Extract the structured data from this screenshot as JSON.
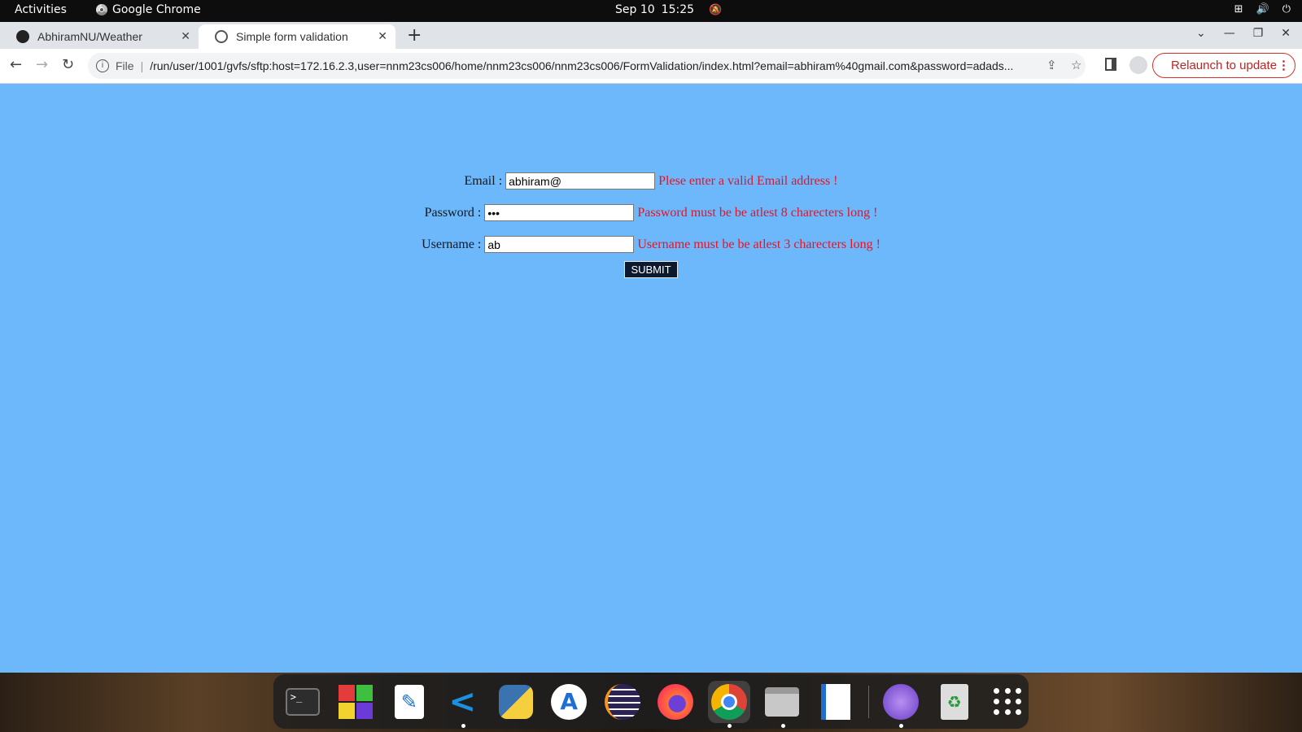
{
  "topbar": {
    "activities": "Activities",
    "app_name": "Google Chrome",
    "date": "Sep 10",
    "time": "15:25"
  },
  "tabs": [
    {
      "title": "AbhiramNU/Weather",
      "icon": "github-icon",
      "active": false
    },
    {
      "title": "Simple form validation",
      "icon": "globe-icon",
      "active": true
    }
  ],
  "toolbar": {
    "file_label": "File",
    "url": "/run/user/1001/gvfs/sftp:host=172.16.2.3,user=nnm23cs006/home/nnm23cs006/nnm23cs006/FormValidation/index.html?email=abhiram%40gmail.com&password=adads...",
    "relaunch_label": "Relaunch to update"
  },
  "form": {
    "email": {
      "label": "Email :",
      "value": "abhiram@",
      "error": "Plese enter a valid Email address !"
    },
    "password": {
      "label": "Password :",
      "value": "abc",
      "error": "Password must be be atlest 8 charecters long !"
    },
    "username": {
      "label": "Username :",
      "value": "ab",
      "error": "Username must be be atlest 3 charecters long !"
    },
    "submit_label": "SUBMIT"
  },
  "colors": {
    "page_background": "#6cb8fb",
    "error_text": "#e0162b",
    "submit_background": "#0d1a2e"
  },
  "dock": {
    "apps": [
      "terminal-icon",
      "tiles-icon",
      "text-editor-icon",
      "vscode-icon",
      "python-icon",
      "app-store-icon",
      "eclipse-icon",
      "firefox-icon",
      "chrome-icon",
      "files-icon",
      "writer-icon",
      "globe-app-icon",
      "trash-icon",
      "show-apps-icon"
    ]
  }
}
